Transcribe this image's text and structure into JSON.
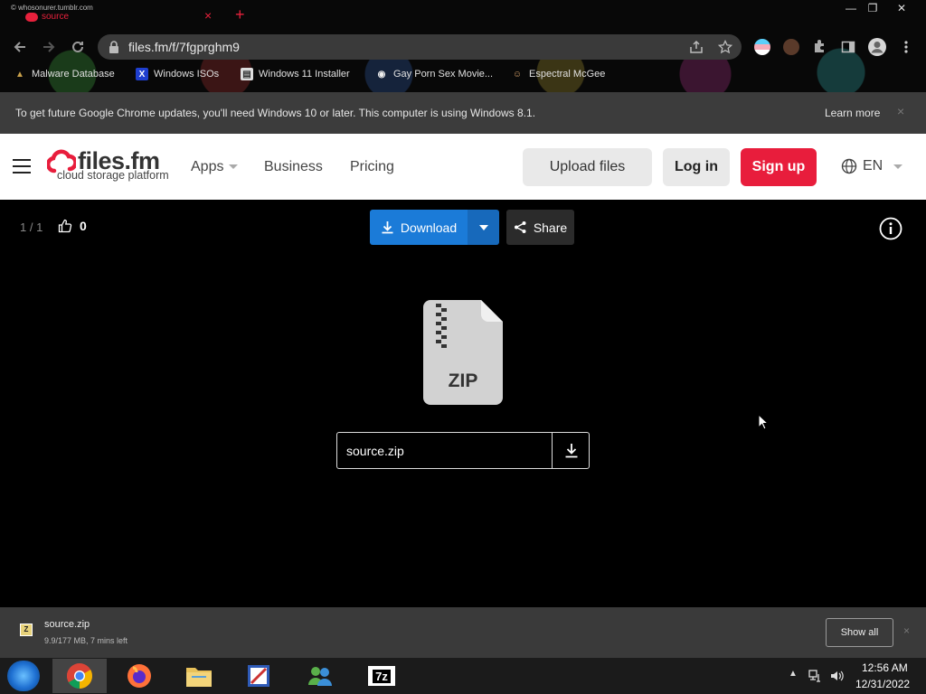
{
  "browser": {
    "tab_small_title": "© whosonurer.tumblr.com",
    "tab_title": "source",
    "tab_close": "×",
    "new_tab": "+",
    "window_controls": [
      "—",
      "❐",
      "✕"
    ],
    "url": "files.fm/f/7fgprghm9",
    "bookmarks": [
      {
        "label": "Malware Database",
        "icon": "malware-icon",
        "glyph": "▲"
      },
      {
        "label": "Windows ISOs",
        "icon": "x-icon",
        "glyph": "X"
      },
      {
        "label": "Windows 11 Installer",
        "icon": "page-icon",
        "glyph": "▤"
      },
      {
        "label": "Gay Porn Sex Movie...",
        "icon": "globe-icon",
        "glyph": "◉"
      },
      {
        "label": "Espectral McGee",
        "icon": "avatar-icon",
        "glyph": "☺"
      }
    ]
  },
  "infobar": {
    "text": "To get future Google Chrome updates, you'll need Windows 10 or later. This computer is using Windows 8.1.",
    "link": "Learn more",
    "close": "×"
  },
  "site": {
    "logo_name": "files.fm",
    "logo_tagline": "cloud storage platform",
    "nav": {
      "apps": "Apps",
      "business": "Business",
      "pricing": "Pricing"
    },
    "upload_label": "Upload files",
    "login_label": "Log in",
    "signup_label": "Sign up",
    "language": "EN",
    "accent_color": "#e81d3c"
  },
  "viewer": {
    "counter": "1 / 1",
    "likes": "0",
    "download_label": "Download",
    "share_label": "Share",
    "file_type": "ZIP",
    "file_name": "source.zip",
    "download_color": "#1b7bd8"
  },
  "download_shelf": {
    "file_name": "source.zip",
    "status": "9.9/177 MB, 7 mins left",
    "show_all": "Show all",
    "close": "×"
  },
  "taskbar": {
    "items": [
      "start",
      "chrome",
      "firefox",
      "file-explorer",
      "paint",
      "messenger",
      "7zip"
    ],
    "sevenzip_label": "7z",
    "time": "12:56 AM",
    "date": "12/31/2022"
  }
}
